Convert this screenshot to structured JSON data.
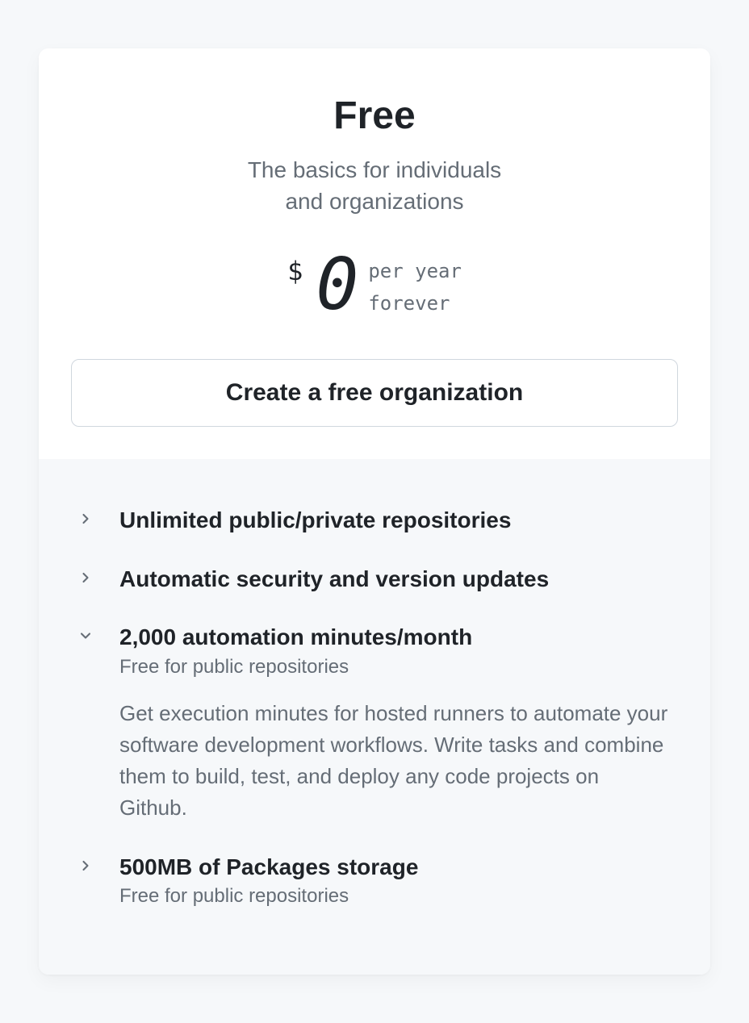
{
  "plan": {
    "title": "Free",
    "subtitle_line1": "The basics for individuals",
    "subtitle_line2": "and organizations",
    "currency": "$",
    "amount": "0",
    "period": "per year",
    "duration": "forever",
    "cta_label": "Create a free organization"
  },
  "features": [
    {
      "title": "Unlimited public/private repositories",
      "expanded": false
    },
    {
      "title": "Automatic security and version updates",
      "expanded": false
    },
    {
      "title": "2,000 automation minutes/month",
      "subtitle": "Free for public repositories",
      "description": "Get execution minutes for hosted runners to automate your software development workflows. Write tasks and combine them to build, test, and deploy any code projects on Github.",
      "expanded": true
    },
    {
      "title": "500MB of Packages storage",
      "subtitle": "Free for public repositories",
      "expanded": false
    }
  ]
}
